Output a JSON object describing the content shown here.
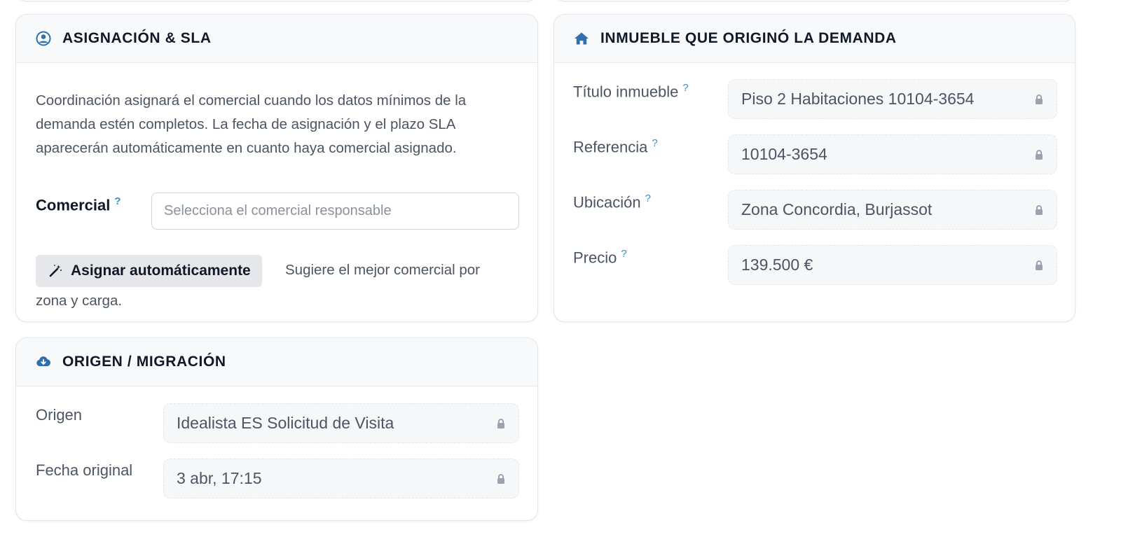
{
  "asignacion": {
    "title": "ASIGNACIÓN & SLA",
    "icon": "user-circle-icon",
    "description": "Coordinación asignará el comercial cuando los datos mínimos de la demanda estén completos. La fecha de asignación y el plazo SLA aparecerán automáticamente en cuanto haya comercial asignado.",
    "comercial_label": "Comercial",
    "comercial_help": "?",
    "comercial_placeholder": "Selecciona el comercial responsable",
    "auto_button_label": "Asignar automáticamente",
    "auto_button_icon": "magic-wand-icon",
    "auto_hint_line1": "Sugiere el mejor comercial por",
    "auto_hint_line2": "zona y carga."
  },
  "inmueble": {
    "title": "INMUEBLE QUE ORIGINÓ LA DEMANDA",
    "icon": "home-icon",
    "fields": [
      {
        "label": "Título inmueble",
        "help": "?",
        "value": "Piso 2 Habitaciones 10104-3654"
      },
      {
        "label": "Referencia",
        "help": "?",
        "value": "10104-3654"
      },
      {
        "label": "Ubicación",
        "help": "?",
        "value": "Zona Concordia, Burjassot"
      },
      {
        "label": "Precio",
        "help": "?",
        "value": "139.500 €"
      }
    ]
  },
  "origen": {
    "title": "ORIGEN / MIGRACIÓN",
    "icon": "cloud-download-icon",
    "fields": [
      {
        "label": "Origen",
        "value": "Idealista ES Solicitud de Visita"
      },
      {
        "label": "Fecha original",
        "value": "3 abr, 17:15"
      }
    ]
  },
  "colors": {
    "accent": "#2f6fad",
    "help": "#3b8fc9",
    "header_bg": "#f8f9fb",
    "readonly_bg": "#f6f7f9"
  }
}
